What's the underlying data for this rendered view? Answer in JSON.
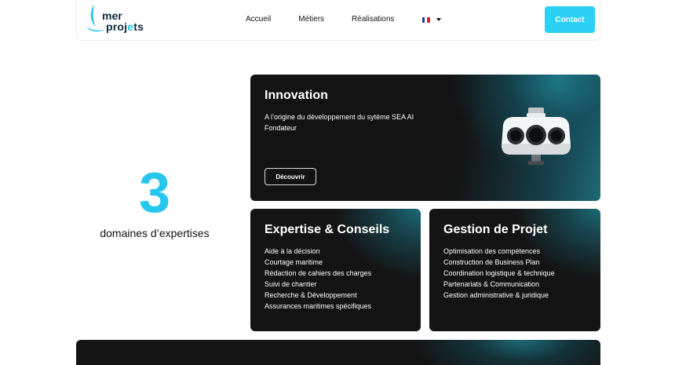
{
  "header": {
    "logo": {
      "line1": "mer",
      "line2_start": "proj",
      "line2_accent": "e",
      "line2_end": "ts"
    },
    "nav": [
      {
        "label": "Accueil"
      },
      {
        "label": "Métiers"
      },
      {
        "label": "Réalisations"
      }
    ],
    "language": {
      "icon": "french-flag-icon",
      "colors": [
        "#1f3ea6",
        "#ffffff",
        "#e3242b"
      ]
    },
    "contact_label": "Contact"
  },
  "stat": {
    "number": "3",
    "label": "domaines d’expertises"
  },
  "cards": {
    "innovation": {
      "title": "Innovation",
      "lines": [
        "A l’origine du développement du sytème SEA AI",
        "Fondateur"
      ],
      "button_label": "Découvrir",
      "image": "surveillance-camera-icon"
    },
    "expertise": {
      "title": "Expertise & Conseils",
      "items": [
        "Aide à la décision",
        "Courtage maritime",
        "Rédaction de cahiers des charges",
        "Suivi de chantier",
        "Recherche & Développement",
        "Assurances maritimes spécifiques"
      ]
    },
    "gestion": {
      "title": "Gestion de Projet",
      "items": [
        "Optimisation des compétences",
        "Construction de Business Plan",
        "Coordination logistique & technique",
        "Partenariats & Communication",
        "Gestion administrative & juridique"
      ]
    }
  },
  "colors": {
    "accent": "#27c6ef",
    "card_bg": "#141414",
    "card_glow": "#1f7a89"
  }
}
